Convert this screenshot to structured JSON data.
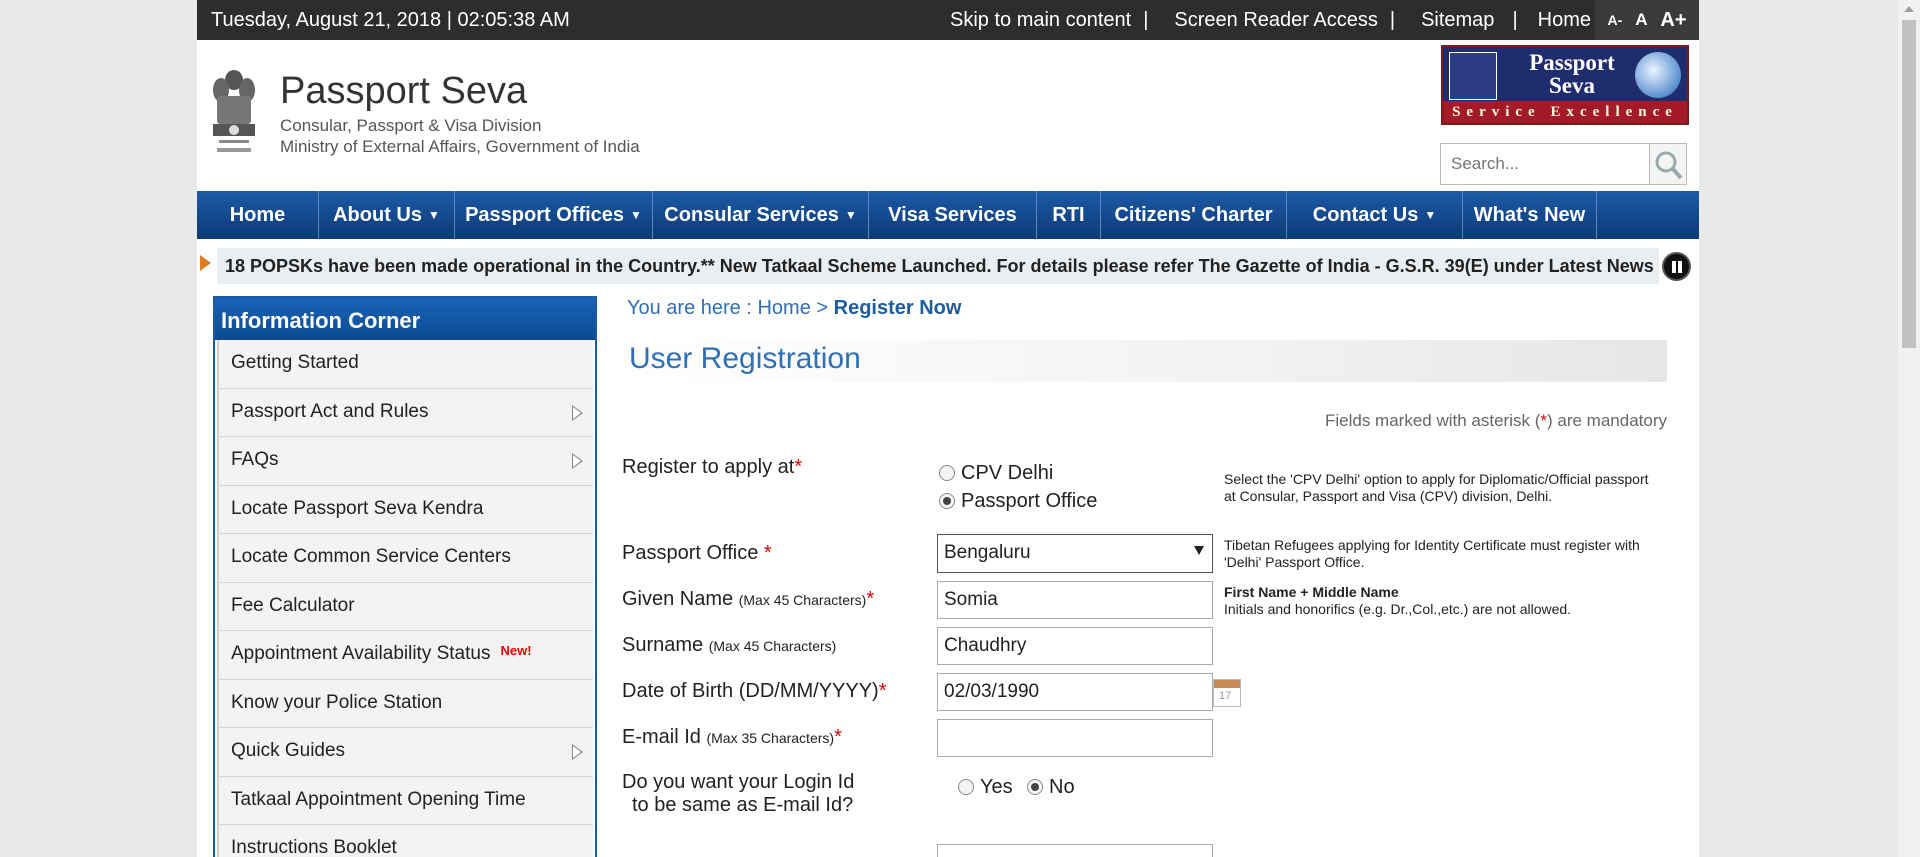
{
  "topbar": {
    "datetime": "Tuesday,  August  21, 2018 | 02:05:38 AM",
    "links": [
      "Skip to main content",
      "Screen Reader Access",
      "Sitemap",
      "Home"
    ],
    "separator": "|",
    "font_decrease": "A-",
    "font_normal": "A",
    "font_increase": "A+"
  },
  "brand": {
    "title": "Passport Seva",
    "sub1": "Consular, Passport & Visa Division",
    "sub2": "Ministry of External Affairs, Government of India",
    "logo_title": "Passport Seva",
    "logo_band": "Service Excellence"
  },
  "search": {
    "placeholder": "Search..."
  },
  "nav": [
    {
      "label": "Home",
      "dropdown": false
    },
    {
      "label": "About Us",
      "dropdown": true
    },
    {
      "label": "Passport Offices",
      "dropdown": true
    },
    {
      "label": "Consular Services",
      "dropdown": true
    },
    {
      "label": "Visa Services",
      "dropdown": false
    },
    {
      "label": "RTI",
      "dropdown": false
    },
    {
      "label": "Citizens' Charter",
      "dropdown": false
    },
    {
      "label": "Contact Us",
      "dropdown": true
    },
    {
      "label": "What's New",
      "dropdown": false
    }
  ],
  "ticker": {
    "text": "18 POPSKs have been made operational in the Country.** New Tatkaal Scheme Launched. For details please refer The Gazette of India - G.S.R. 39(E) under Latest News"
  },
  "sidebar": {
    "title": "Information Corner",
    "new_badge": "New!",
    "items": [
      {
        "label": "Getting Started",
        "sub": false
      },
      {
        "label": "Passport Act and Rules",
        "sub": true
      },
      {
        "label": "FAQs",
        "sub": true
      },
      {
        "label": "Locate Passport Seva Kendra",
        "sub": false
      },
      {
        "label": "Locate Common Service Centers",
        "sub": false
      },
      {
        "label": "Fee Calculator",
        "sub": false
      },
      {
        "label": "Appointment Availability Status",
        "sub": false,
        "new": true
      },
      {
        "label": "Know your Police Station",
        "sub": false
      },
      {
        "label": "Quick Guides",
        "sub": true
      },
      {
        "label": "Tatkaal Appointment Opening Time",
        "sub": false
      },
      {
        "label": "Instructions Booklet",
        "sub": false
      }
    ]
  },
  "breadcrumb": {
    "prefix": "You are here : ",
    "home": "Home",
    "sep": " > ",
    "current": "Register Now"
  },
  "form": {
    "title": "User Registration",
    "mandatory_note": "Fields marked with asterisk (",
    "mandatory_star": "*",
    "mandatory_note_end": ") are mandatory",
    "register_at": {
      "label": "Register to apply at",
      "options": [
        "CPV Delhi",
        "Passport Office"
      ],
      "selected": "Passport Office",
      "help": "Select the 'CPV Delhi' option to apply for Diplomatic/Official passport at Consular, Passport and Visa (CPV) division, Delhi."
    },
    "passport_office": {
      "label": "Passport Office ",
      "value": "Bengaluru",
      "help": "Tibetan Refugees applying for Identity Certificate must register with 'Delhi' Passport Office."
    },
    "given_name": {
      "label": "Given Name ",
      "hint": "(Max 45 Characters)",
      "value": "Somia",
      "help_bold": "First Name + Middle Name",
      "help": "Initials and honorifics (e.g. Dr.,Col.,etc.) are not allowed."
    },
    "surname": {
      "label": "Surname ",
      "hint": "(Max 45 Characters)",
      "value": "Chaudhry"
    },
    "dob": {
      "label": "Date of Birth (DD/MM/YYYY)",
      "value": "02/03/1990",
      "cal_day": "17"
    },
    "email": {
      "label": "E-mail Id ",
      "hint": "(Max 35 Characters)",
      "value": ""
    },
    "login_same": {
      "label1": "Do you want your Login Id",
      "label2": "to be same as E-mail Id?",
      "options": [
        "Yes",
        "No"
      ],
      "selected": "No"
    }
  }
}
